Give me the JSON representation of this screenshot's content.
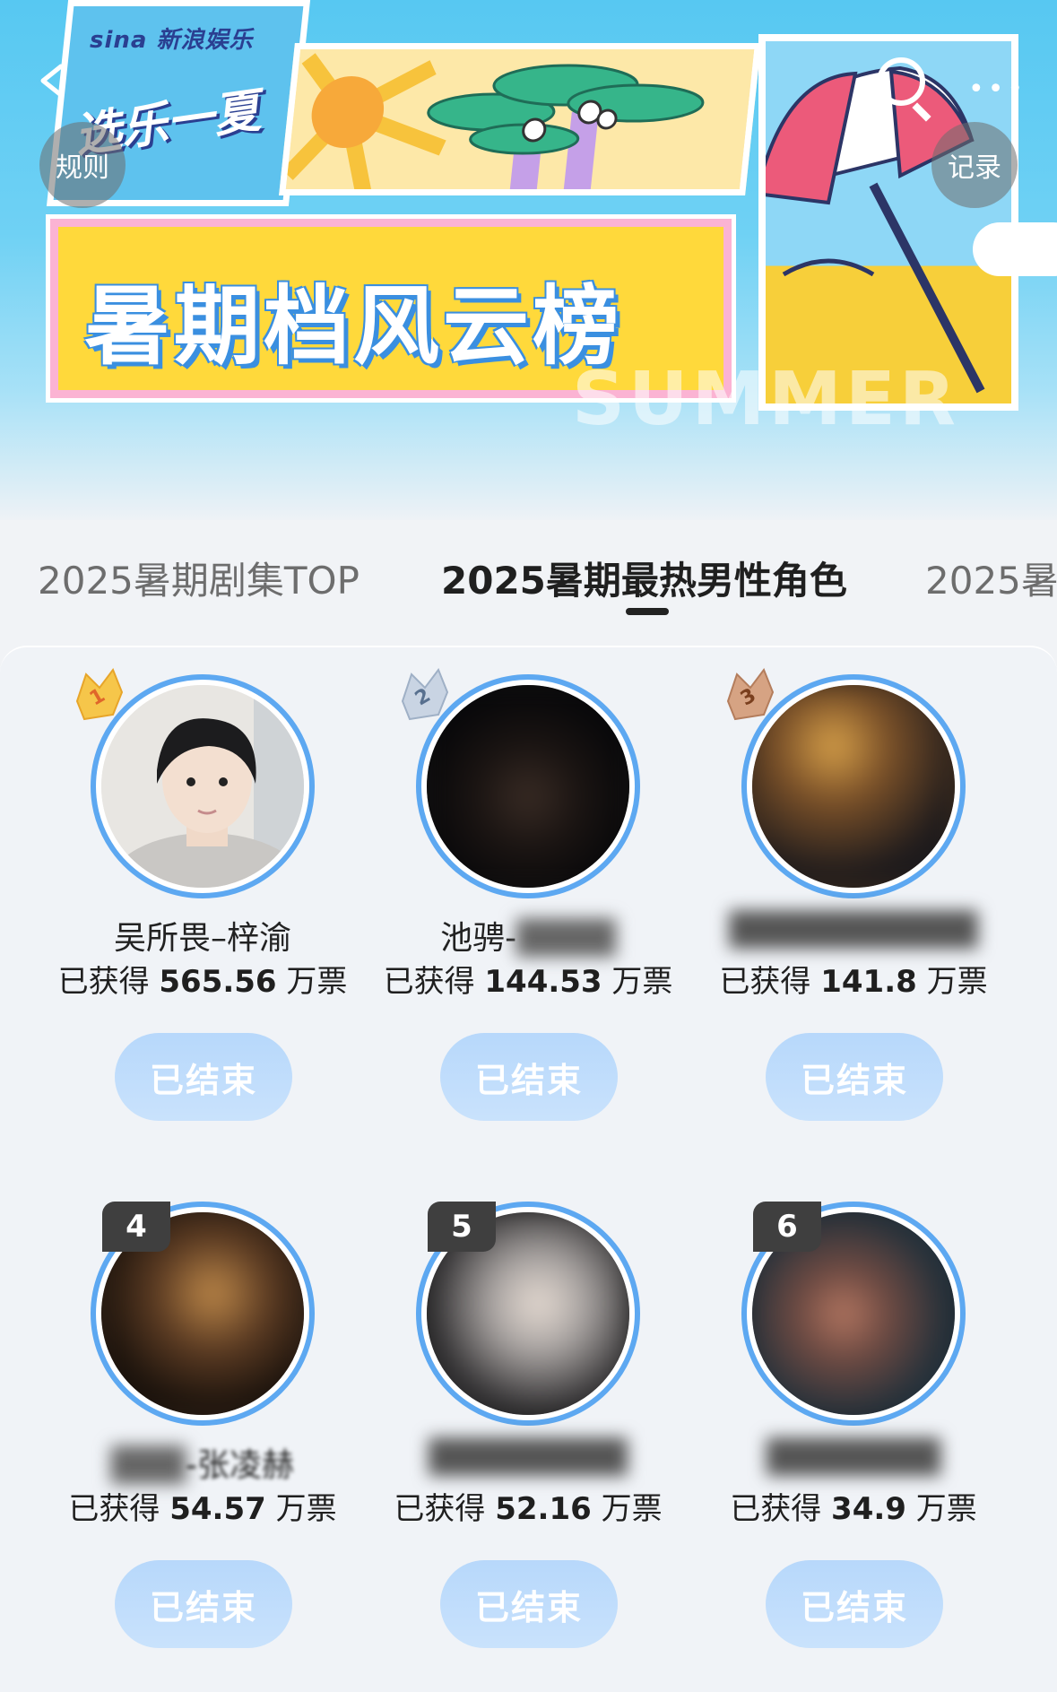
{
  "header": {
    "logo": "sina 新浪娱乐",
    "slogan": "选乐一夏",
    "banner_title": "暑期档风云榜",
    "banner_watermark": "SUMMER",
    "rules_button": "规则",
    "records_button": "记录",
    "more_glyph": "•••"
  },
  "tabs": [
    {
      "label": "2025暑期剧集TOP",
      "active": false
    },
    {
      "label": "2025暑期最热男性角色",
      "active": true
    },
    {
      "label": "2025暑",
      "active": false
    }
  ],
  "ranking": [
    {
      "rank": "1",
      "name": "吴所畏–梓渝",
      "votes_prefix": "已获得",
      "votes": "565.56",
      "votes_unit": "万票",
      "button": "已结束",
      "name_blurred": false
    },
    {
      "rank": "2",
      "name": "池骋-",
      "votes_prefix": "已获得",
      "votes": "144.53",
      "votes_unit": "万票",
      "button": "已结束",
      "name_blurred": true
    },
    {
      "rank": "3",
      "name": "",
      "votes_prefix": "已获得",
      "votes": "141.8",
      "votes_unit": "万票",
      "button": "已结束",
      "name_blurred": true
    },
    {
      "rank": "4",
      "name": "-张凌赫",
      "votes_prefix": "已获得",
      "votes": "54.57",
      "votes_unit": "万票",
      "button": "已结束",
      "name_blurred": true
    },
    {
      "rank": "5",
      "name": "",
      "votes_prefix": "已获得",
      "votes": "52.16",
      "votes_unit": "万票",
      "button": "已结束",
      "name_blurred": true
    },
    {
      "rank": "6",
      "name": "",
      "votes_prefix": "已获得",
      "votes": "34.9",
      "votes_unit": "万票",
      "button": "已结束",
      "name_blurred": true
    }
  ],
  "colors": {
    "accent_ring": "#5da8f1",
    "ended_button": "#c2ddfb",
    "medal_gold": "#f6c64a",
    "medal_silver": "#c9d4e3",
    "medal_bronze": "#d6a383"
  }
}
